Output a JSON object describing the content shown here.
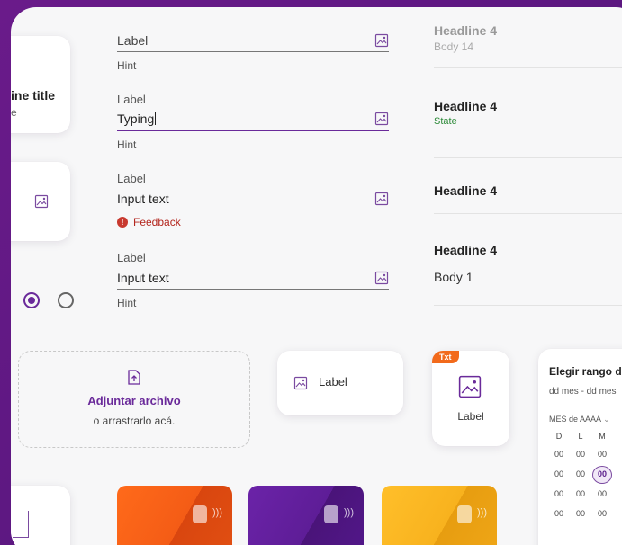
{
  "fields": [
    {
      "label": "Label",
      "value": "",
      "hint": "Hint",
      "state": "default"
    },
    {
      "label": "Label",
      "value": "Typing",
      "hint": "Hint",
      "state": "active"
    },
    {
      "label": "Label",
      "value": "Input text",
      "feedback": "Feedback",
      "state": "error"
    },
    {
      "label": "Label",
      "value": "Input text",
      "hint": "Hint",
      "state": "filled"
    }
  ],
  "left_card": {
    "title": "ine title",
    "subtitle": "e"
  },
  "list_items": [
    {
      "headline": "Headline 4",
      "body": "Body 14"
    },
    {
      "headline": "Headline 4",
      "state": "State"
    },
    {
      "headline": "Headline 4"
    },
    {
      "headline": "Headline 4",
      "body": "Body 1"
    }
  ],
  "upload": {
    "title": "Adjuntar archivo",
    "subtitle": "o arrastrarlo acá."
  },
  "chip_card": {
    "label": "Label"
  },
  "tile_card": {
    "badge": "Txt",
    "label": "Label"
  },
  "calendar": {
    "title": "Elegir rango d",
    "range_placeholder": "dd mes - dd mes",
    "month": "MES de AAAA",
    "weekdays": [
      "D",
      "L",
      "M"
    ],
    "rows": [
      [
        "00",
        "00",
        "00"
      ],
      [
        "00",
        "00",
        "00"
      ],
      [
        "00",
        "00",
        "00"
      ],
      [
        "00",
        "00",
        "00"
      ]
    ],
    "selected": "00"
  },
  "cards": [
    {
      "name": "orange",
      "color": "#f26a1b"
    },
    {
      "name": "purple",
      "color": "#5a1d8a"
    },
    {
      "name": "yellow",
      "color": "#f5b21b"
    }
  ]
}
